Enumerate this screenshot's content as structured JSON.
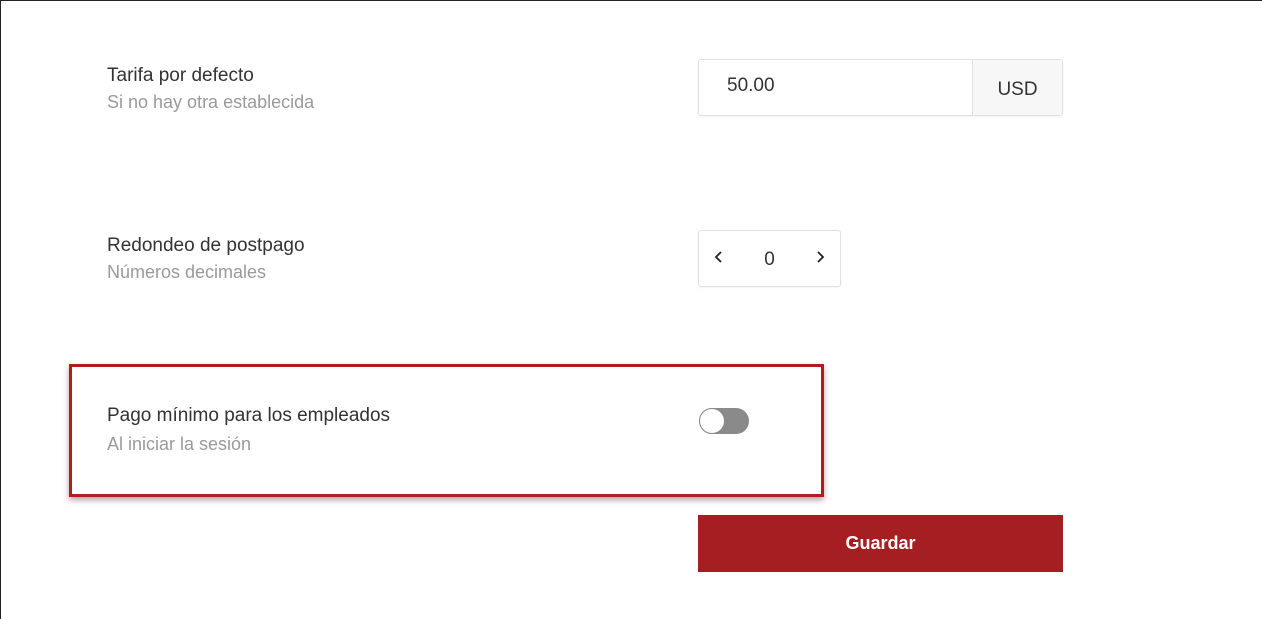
{
  "default_rate": {
    "title": "Tarifa por defecto",
    "subtitle": "Si no hay otra establecida",
    "value": "50.00",
    "currency": "USD"
  },
  "postpay_rounding": {
    "title": "Redondeo de postpago",
    "subtitle": "Números decimales",
    "value": "0",
    "decrement_icon": "chevron-left-icon",
    "increment_icon": "chevron-right-icon"
  },
  "employee_min_payment": {
    "title": "Pago mínimo para los empleados",
    "subtitle": "Al iniciar la sesión",
    "toggle_on": false
  },
  "actions": {
    "save_label": "Guardar"
  },
  "colors": {
    "accent": "#a51e22",
    "highlight_border": "#b01c22",
    "toggle_off": "#8a8a8a"
  }
}
